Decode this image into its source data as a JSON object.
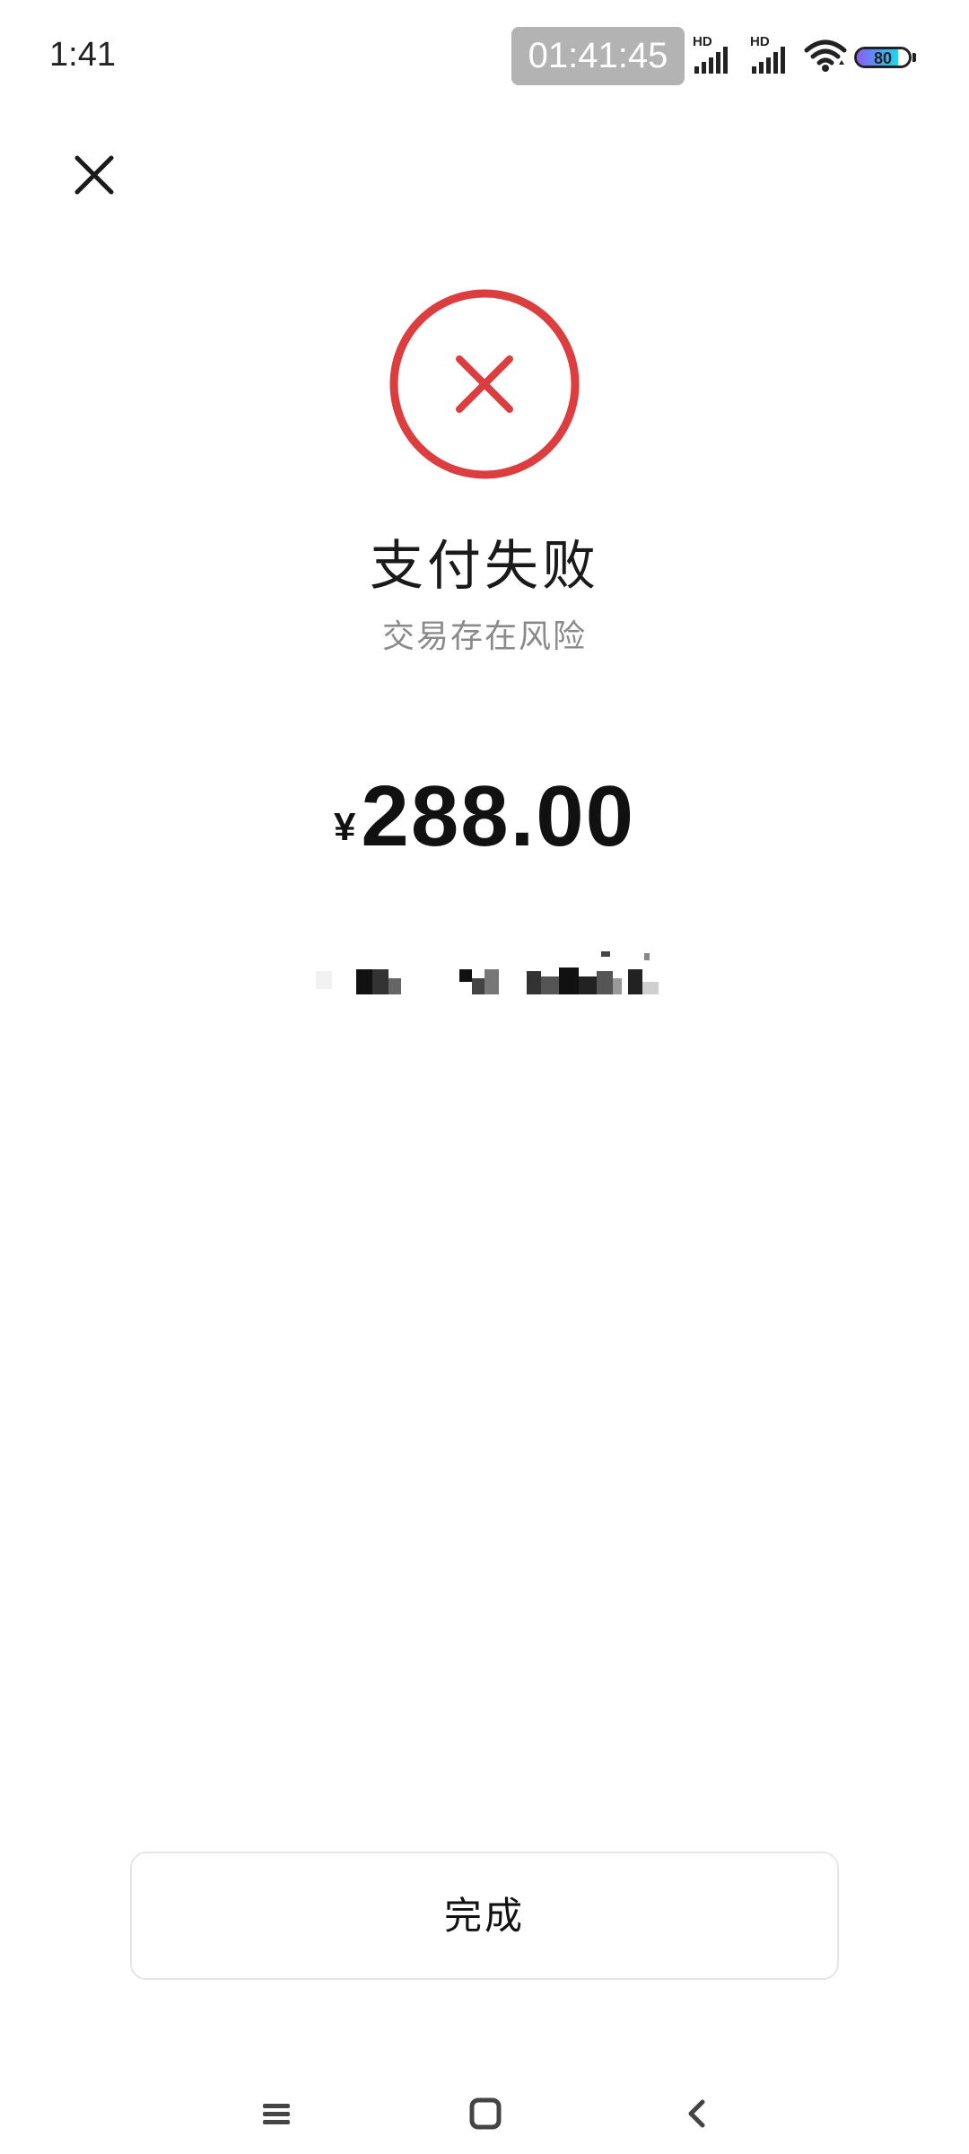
{
  "status_bar": {
    "time": "1:41",
    "clock_overlay": "01:41:45",
    "signal_1_label": "HD",
    "signal_2_label": "HD",
    "battery_level": "80",
    "battery_percent": 80
  },
  "icons": {
    "close": "close-icon",
    "fail": "fail-circle-x-icon",
    "wifi": "wifi-icon",
    "nav_menu": "menu-icon",
    "nav_home": "home-icon",
    "nav_back": "back-icon"
  },
  "colors": {
    "fail_red": "#dc3d3f",
    "button_border": "#e6e6e6",
    "subtitle_gray": "#8a8a8a"
  },
  "result": {
    "title": "支付失败",
    "subtitle": "交易存在风险",
    "currency_symbol": "¥",
    "amount": "288.00"
  },
  "actions": {
    "done_label": "完成"
  }
}
